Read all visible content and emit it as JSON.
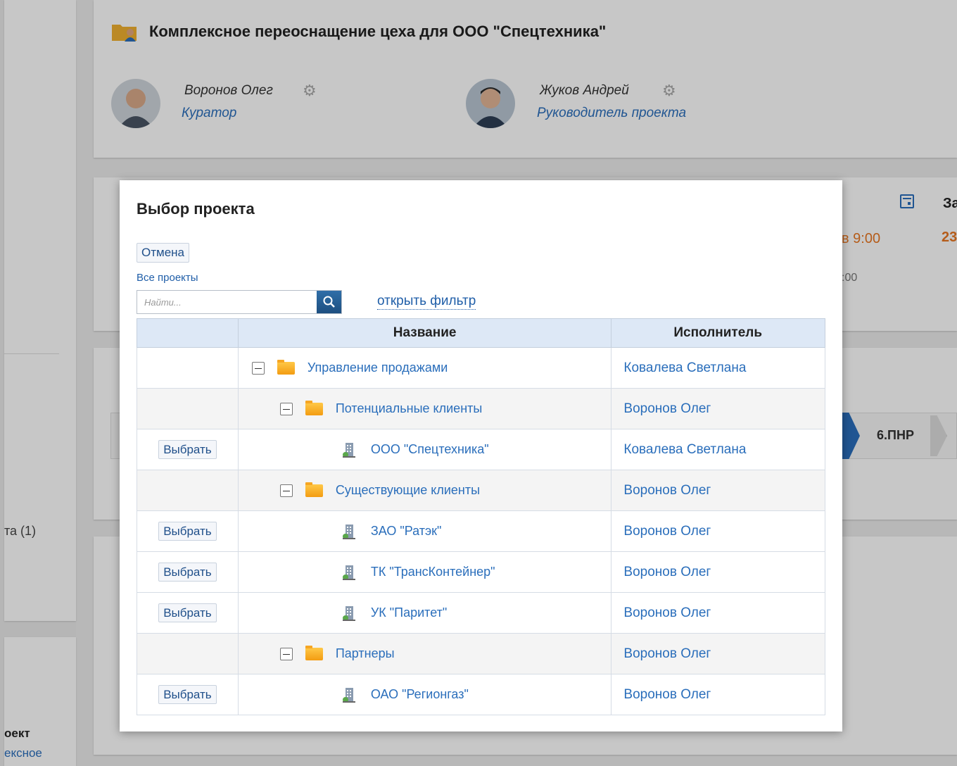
{
  "background": {
    "project_title": "Комплексное переоснащение цеха для ООО \"Спецтехника\"",
    "people": [
      {
        "name": "Воронов Олег",
        "role": "Куратор"
      },
      {
        "name": "Жуков Андрей",
        "role": "Руководитель проекта"
      }
    ],
    "date_fragment_time": "в 9:00",
    "date_fragment_number": "23",
    "date_fragment_small": ":00",
    "date_header_fragment": "За",
    "stage_label": "6.ПНР",
    "left_link_fragment": "та (1)",
    "left_project_label": "оект",
    "left_project_link": "ексное"
  },
  "modal": {
    "title": "Выбор проекта",
    "cancel_label": "Отмена",
    "all_projects_label": "Все проекты",
    "search_placeholder": "Найти...",
    "open_filter_label": "открыть фильтр",
    "columns": {
      "select": "",
      "name": "Название",
      "executor": "Исполнитель"
    },
    "select_label": "Выбрать",
    "rows": [
      {
        "name": "Управление продажами",
        "executor": "Ковалева Светлана",
        "level": 0,
        "type": "folder",
        "selectable": false
      },
      {
        "name": "Потенциальные клиенты",
        "executor": "Воронов Олег",
        "level": 1,
        "type": "folder",
        "selectable": false
      },
      {
        "name": "ООО \"Спецтехника\"",
        "executor": "Ковалева Светлана",
        "level": 2,
        "type": "project",
        "selectable": true
      },
      {
        "name": "Существующие клиенты",
        "executor": "Воронов Олег",
        "level": 1,
        "type": "folder",
        "selectable": false
      },
      {
        "name": "ЗАО \"Ратэк\"",
        "executor": "Воронов Олег",
        "level": 2,
        "type": "project",
        "selectable": true
      },
      {
        "name": "ТК \"ТрансКонтейнер\"",
        "executor": "Воронов Олег",
        "level": 2,
        "type": "project",
        "selectable": true
      },
      {
        "name": "УК \"Паритет\"",
        "executor": "Воронов Олег",
        "level": 2,
        "type": "project",
        "selectable": true
      },
      {
        "name": "Партнеры",
        "executor": "Воронов Олег",
        "level": 1,
        "type": "folder",
        "selectable": false
      },
      {
        "name": "ОАО \"Регионгаз\"",
        "executor": "Воронов Олег",
        "level": 2,
        "type": "project",
        "selectable": true
      }
    ]
  },
  "colors": {
    "link": "#2a6ebb",
    "accent_orange": "#e87722",
    "header_bg": "#dde8f6"
  }
}
